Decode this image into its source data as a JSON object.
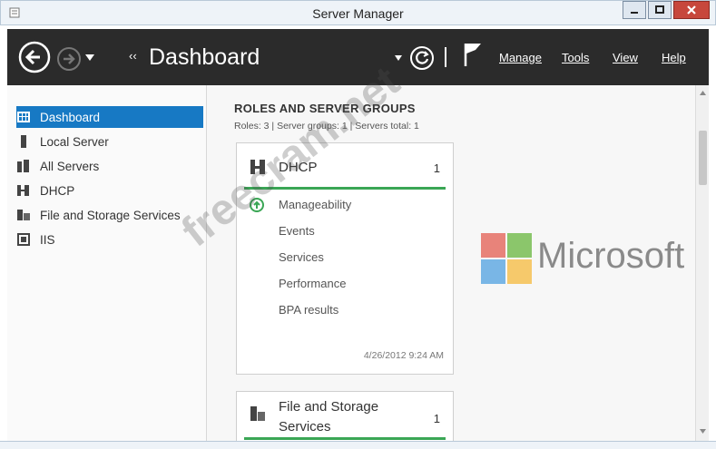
{
  "window": {
    "title": "Server Manager"
  },
  "toolbar": {
    "breadcrumb_arrows": "‹‹",
    "breadcrumb": "Dashboard",
    "menus": [
      "Manage",
      "Tools",
      "View",
      "Help"
    ]
  },
  "sidebar": {
    "items": [
      {
        "label": "Dashboard",
        "icon": "dashboard-icon",
        "selected": true
      },
      {
        "label": "Local Server",
        "icon": "server-icon"
      },
      {
        "label": "All Servers",
        "icon": "servers-icon"
      },
      {
        "label": "DHCP",
        "icon": "dhcp-icon"
      },
      {
        "label": "File and Storage Services",
        "icon": "file-storage-icon"
      },
      {
        "label": "IIS",
        "icon": "iis-icon"
      }
    ]
  },
  "main": {
    "section_title": "ROLES AND SERVER GROUPS",
    "section_sub": "Roles: 3 | Server groups: 1 | Servers total: 1",
    "cards": [
      {
        "title": "DHCP",
        "count": "1",
        "links": [
          "Manageability",
          "Events",
          "Services",
          "Performance",
          "BPA results"
        ],
        "date": "4/26/2012 9:24 AM"
      },
      {
        "title_line1": "File and Storage",
        "title_line2": "Services",
        "count": "1"
      }
    ]
  },
  "brand": {
    "text": "Microsoft"
  },
  "watermark": "freecram.net",
  "colors": {
    "accent": "#1779c4",
    "toolbar": "#2b2b2b",
    "status_green": "#3aa655"
  }
}
